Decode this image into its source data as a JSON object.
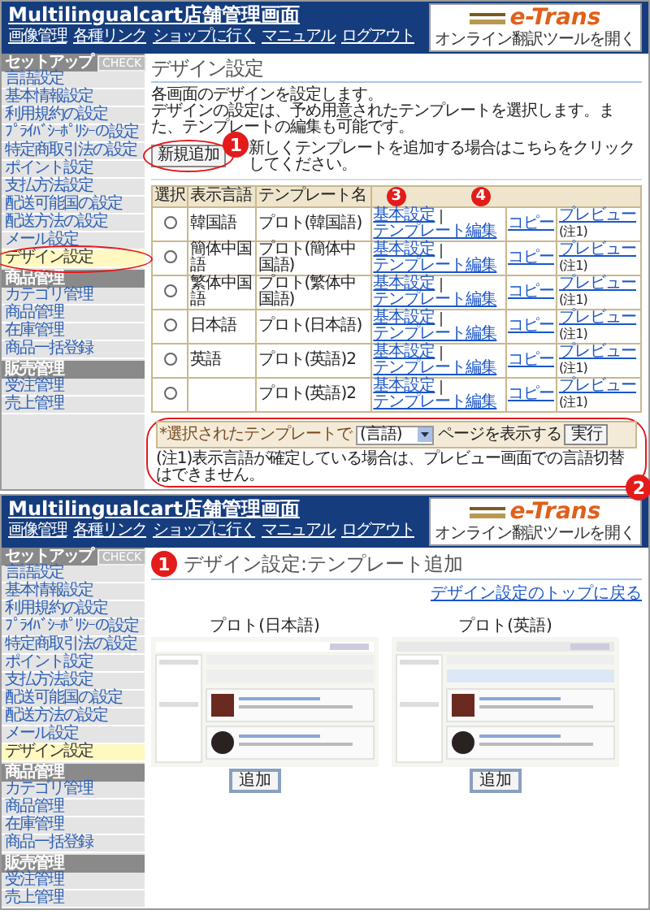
{
  "screens": [
    {
      "kind": "list",
      "header": {
        "title": "Multilingualcart店舗管理画面",
        "nav": [
          "画像管理",
          "各種リンク",
          "ショップに行く",
          "マニュアル",
          "ログアウト"
        ],
        "banner": {
          "logo": "e-Trans",
          "subtitle": "オンライン翻訳ツールを開く"
        }
      },
      "sidebar": [
        {
          "header": "セットアップ",
          "badge": "CHECK",
          "items": [
            {
              "label": "言語設定",
              "selected": false,
              "circled": false
            },
            {
              "label": "基本情報設定",
              "selected": false,
              "circled": false
            },
            {
              "label": "利用規約の設定",
              "selected": false,
              "circled": false
            },
            {
              "label": "ﾌﾟﾗｲﾊﾞｼｰﾎﾟﾘｼｰの設定",
              "selected": false,
              "circled": false
            },
            {
              "label": "特定商取引法の設定",
              "selected": false,
              "circled": false
            },
            {
              "label": "ポイント設定",
              "selected": false,
              "circled": false
            },
            {
              "label": "支払方法設定",
              "selected": false,
              "circled": false
            },
            {
              "label": "配送可能国の設定",
              "selected": false,
              "circled": false
            },
            {
              "label": "配送方法の設定",
              "selected": false,
              "circled": false
            },
            {
              "label": "メール設定",
              "selected": false,
              "circled": false
            },
            {
              "label": "デザイン設定",
              "selected": true,
              "circled": true
            }
          ]
        },
        {
          "header": "商品管理",
          "items": [
            {
              "label": "カテゴリ管理",
              "selected": false,
              "circled": false
            },
            {
              "label": "商品管理",
              "selected": false,
              "circled": false
            },
            {
              "label": "在庫管理",
              "selected": false,
              "circled": false
            },
            {
              "label": "商品一括登録",
              "selected": false,
              "circled": false
            }
          ]
        },
        {
          "header": "販売管理",
          "items": [
            {
              "label": "受注管理",
              "selected": false,
              "circled": false
            },
            {
              "label": "売上管理",
              "selected": false,
              "circled": false
            }
          ]
        }
      ],
      "title": "デザイン設定",
      "description": [
        "各画面のデザインを設定します。",
        "デザインの設定は、予め用意されたテンプレートを選択します。また、テンプレートの編集も可能です。"
      ],
      "new_button": {
        "label": "新規追加",
        "circled": true,
        "callout": "1"
      },
      "new_hint": "新しくテンプレートを追加する場合はこちらをクリックしてください。",
      "table": {
        "columns": [
          "選択",
          "表示言語",
          "テンプレート名"
        ],
        "header_callouts": [
          "3",
          "4"
        ],
        "rows": [
          {
            "selected": false,
            "language": "韓国語",
            "template": "プロト(韓国語)",
            "links": [
              "基本設定",
              "テンプレート編集"
            ],
            "copy": "コピー",
            "preview": "プレビュー",
            "note": "(注1)"
          },
          {
            "selected": false,
            "language": "簡体中国語",
            "template": "プロト(簡体中国語)",
            "links": [
              "基本設定",
              "テンプレート編集"
            ],
            "copy": "コピー",
            "preview": "プレビュー",
            "note": "(注1)"
          },
          {
            "selected": false,
            "language": "繁体中国語",
            "template": "プロト(繁体中国語)",
            "links": [
              "基本設定",
              "テンプレート編集"
            ],
            "copy": "コピー",
            "preview": "プレビュー",
            "note": "(注1)"
          },
          {
            "selected": false,
            "language": "日本語",
            "template": "プロト(日本語)",
            "links": [
              "基本設定",
              "テンプレート編集"
            ],
            "copy": "コピー",
            "preview": "プレビュー",
            "note": "(注1)"
          },
          {
            "selected": false,
            "language": "英語",
            "template": "プロト(英語)2",
            "links": [
              "基本設定",
              "テンプレート編集"
            ],
            "copy": "コピー",
            "preview": "プレビュー",
            "note": "(注1)"
          },
          {
            "selected": false,
            "template": "プロト(英語)2",
            "links": [
              "基本設定",
              "テンプレート編集"
            ],
            "copy": "コピー",
            "preview": "プレビュー",
            "note": "(注1)"
          }
        ],
        "footer": {
          "prefix": "*選択されたテンプレートで",
          "select": "(言語)",
          "suffix": "ページを表示する",
          "button": "実行",
          "circled": true,
          "callout": "2"
        }
      },
      "note": "(注1)表示言語が確定している場合は、プレビュー画面での言語切替はできません。"
    },
    {
      "kind": "add",
      "header": {
        "title": "Multilingualcart店舗管理画面",
        "nav": [
          "画像管理",
          "各種リンク",
          "ショップに行く",
          "マニュアル",
          "ログアウト"
        ],
        "banner": {
          "logo": "e-Trans",
          "subtitle": "オンライン翻訳ツールを開く"
        }
      },
      "sidebar": [
        {
          "header": "セットアップ",
          "badge": "CHECK",
          "items": [
            {
              "label": "言語設定",
              "selected": false,
              "circled": false
            },
            {
              "label": "基本情報設定",
              "selected": false,
              "circled": false
            },
            {
              "label": "利用規約の設定",
              "selected": false,
              "circled": false
            },
            {
              "label": "ﾌﾟﾗｲﾊﾞｼｰﾎﾟﾘｼｰの設定",
              "selected": false,
              "circled": false
            },
            {
              "label": "特定商取引法の設定",
              "selected": false,
              "circled": false
            },
            {
              "label": "ポイント設定",
              "selected": false,
              "circled": false
            },
            {
              "label": "支払方法設定",
              "selected": false,
              "circled": false
            },
            {
              "label": "配送可能国の設定",
              "selected": false,
              "circled": false
            },
            {
              "label": "配送方法の設定",
              "selected": false,
              "circled": false
            },
            {
              "label": "メール設定",
              "selected": false,
              "circled": false
            },
            {
              "label": "デザイン設定",
              "selected": true,
              "circled": false
            }
          ]
        },
        {
          "header": "商品管理",
          "items": [
            {
              "label": "カテゴリ管理",
              "selected": false,
              "circled": false
            },
            {
              "label": "商品管理",
              "selected": false,
              "circled": false
            },
            {
              "label": "在庫管理",
              "selected": false,
              "circled": false
            },
            {
              "label": "商品一括登録",
              "selected": false,
              "circled": false
            }
          ]
        },
        {
          "header": "販売管理",
          "items": [
            {
              "label": "受注管理",
              "selected": false,
              "circled": false
            },
            {
              "label": "売上管理",
              "selected": false,
              "circled": false
            }
          ]
        }
      ],
      "title_callout": "1",
      "title": "デザイン設定:テンプレート追加",
      "back_link": "デザイン設定のトップに戻る",
      "templates": [
        {
          "name": "プロト(日本語)",
          "button": "追加"
        },
        {
          "name": "プロト(英語)",
          "button": "追加"
        }
      ]
    }
  ]
}
